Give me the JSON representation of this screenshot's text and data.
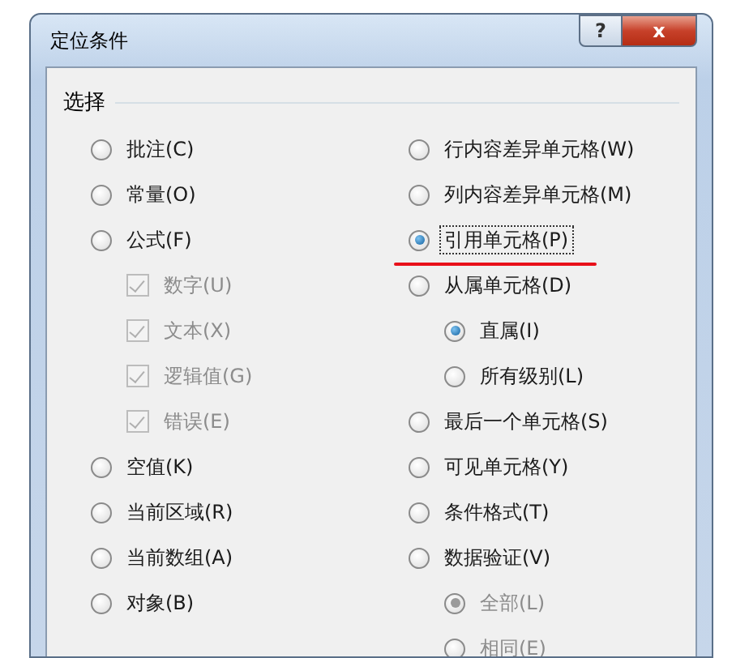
{
  "window": {
    "title": "定位条件",
    "buttons": [
      {
        "kind": "help",
        "label": "?"
      },
      {
        "kind": "close",
        "label": "x"
      }
    ]
  },
  "group": {
    "title": "选择",
    "left": [
      {
        "kind": "radio",
        "label": "批注(C)",
        "selected": false,
        "disabled": false
      },
      {
        "kind": "radio",
        "label": "常量(O)",
        "selected": false,
        "disabled": false
      },
      {
        "kind": "radio",
        "label": "公式(F)",
        "selected": false,
        "disabled": false,
        "children": [
          {
            "kind": "checkbox",
            "label": "数字(U)",
            "checked": true,
            "disabled": true
          },
          {
            "kind": "checkbox",
            "label": "文本(X)",
            "checked": true,
            "disabled": true
          },
          {
            "kind": "checkbox",
            "label": "逻辑值(G)",
            "checked": true,
            "disabled": true
          },
          {
            "kind": "checkbox",
            "label": "错误(E)",
            "checked": true,
            "disabled": true
          }
        ]
      },
      {
        "kind": "radio",
        "label": "空值(K)",
        "selected": false,
        "disabled": false
      },
      {
        "kind": "radio",
        "label": "当前区域(R)",
        "selected": false,
        "disabled": false
      },
      {
        "kind": "radio",
        "label": "当前数组(A)",
        "selected": false,
        "disabled": false
      },
      {
        "kind": "radio",
        "label": "对象(B)",
        "selected": false,
        "disabled": false
      }
    ],
    "right": [
      {
        "kind": "radio",
        "label": "行内容差异单元格(W)",
        "selected": false,
        "disabled": false
      },
      {
        "kind": "radio",
        "label": "列内容差异单元格(M)",
        "selected": false,
        "disabled": false
      },
      {
        "kind": "radio",
        "label": "引用单元格(P)",
        "selected": true,
        "disabled": false,
        "focused": true,
        "underlined": true
      },
      {
        "kind": "radio",
        "label": "从属单元格(D)",
        "selected": false,
        "disabled": false,
        "children": [
          {
            "kind": "radio",
            "label": "直属(I)",
            "selected": true,
            "disabled": false
          },
          {
            "kind": "radio",
            "label": "所有级别(L)",
            "selected": false,
            "disabled": false
          }
        ]
      },
      {
        "kind": "radio",
        "label": "最后一个单元格(S)",
        "selected": false,
        "disabled": false
      },
      {
        "kind": "radio",
        "label": "可见单元格(Y)",
        "selected": false,
        "disabled": false
      },
      {
        "kind": "radio",
        "label": "条件格式(T)",
        "selected": false,
        "disabled": false
      },
      {
        "kind": "radio",
        "label": "数据验证(V)",
        "selected": false,
        "disabled": false,
        "children": [
          {
            "kind": "radio",
            "label": "全部(L)",
            "selected": true,
            "disabled": true
          },
          {
            "kind": "radio",
            "label": "相同(E)",
            "selected": false,
            "disabled": true
          }
        ]
      }
    ]
  }
}
